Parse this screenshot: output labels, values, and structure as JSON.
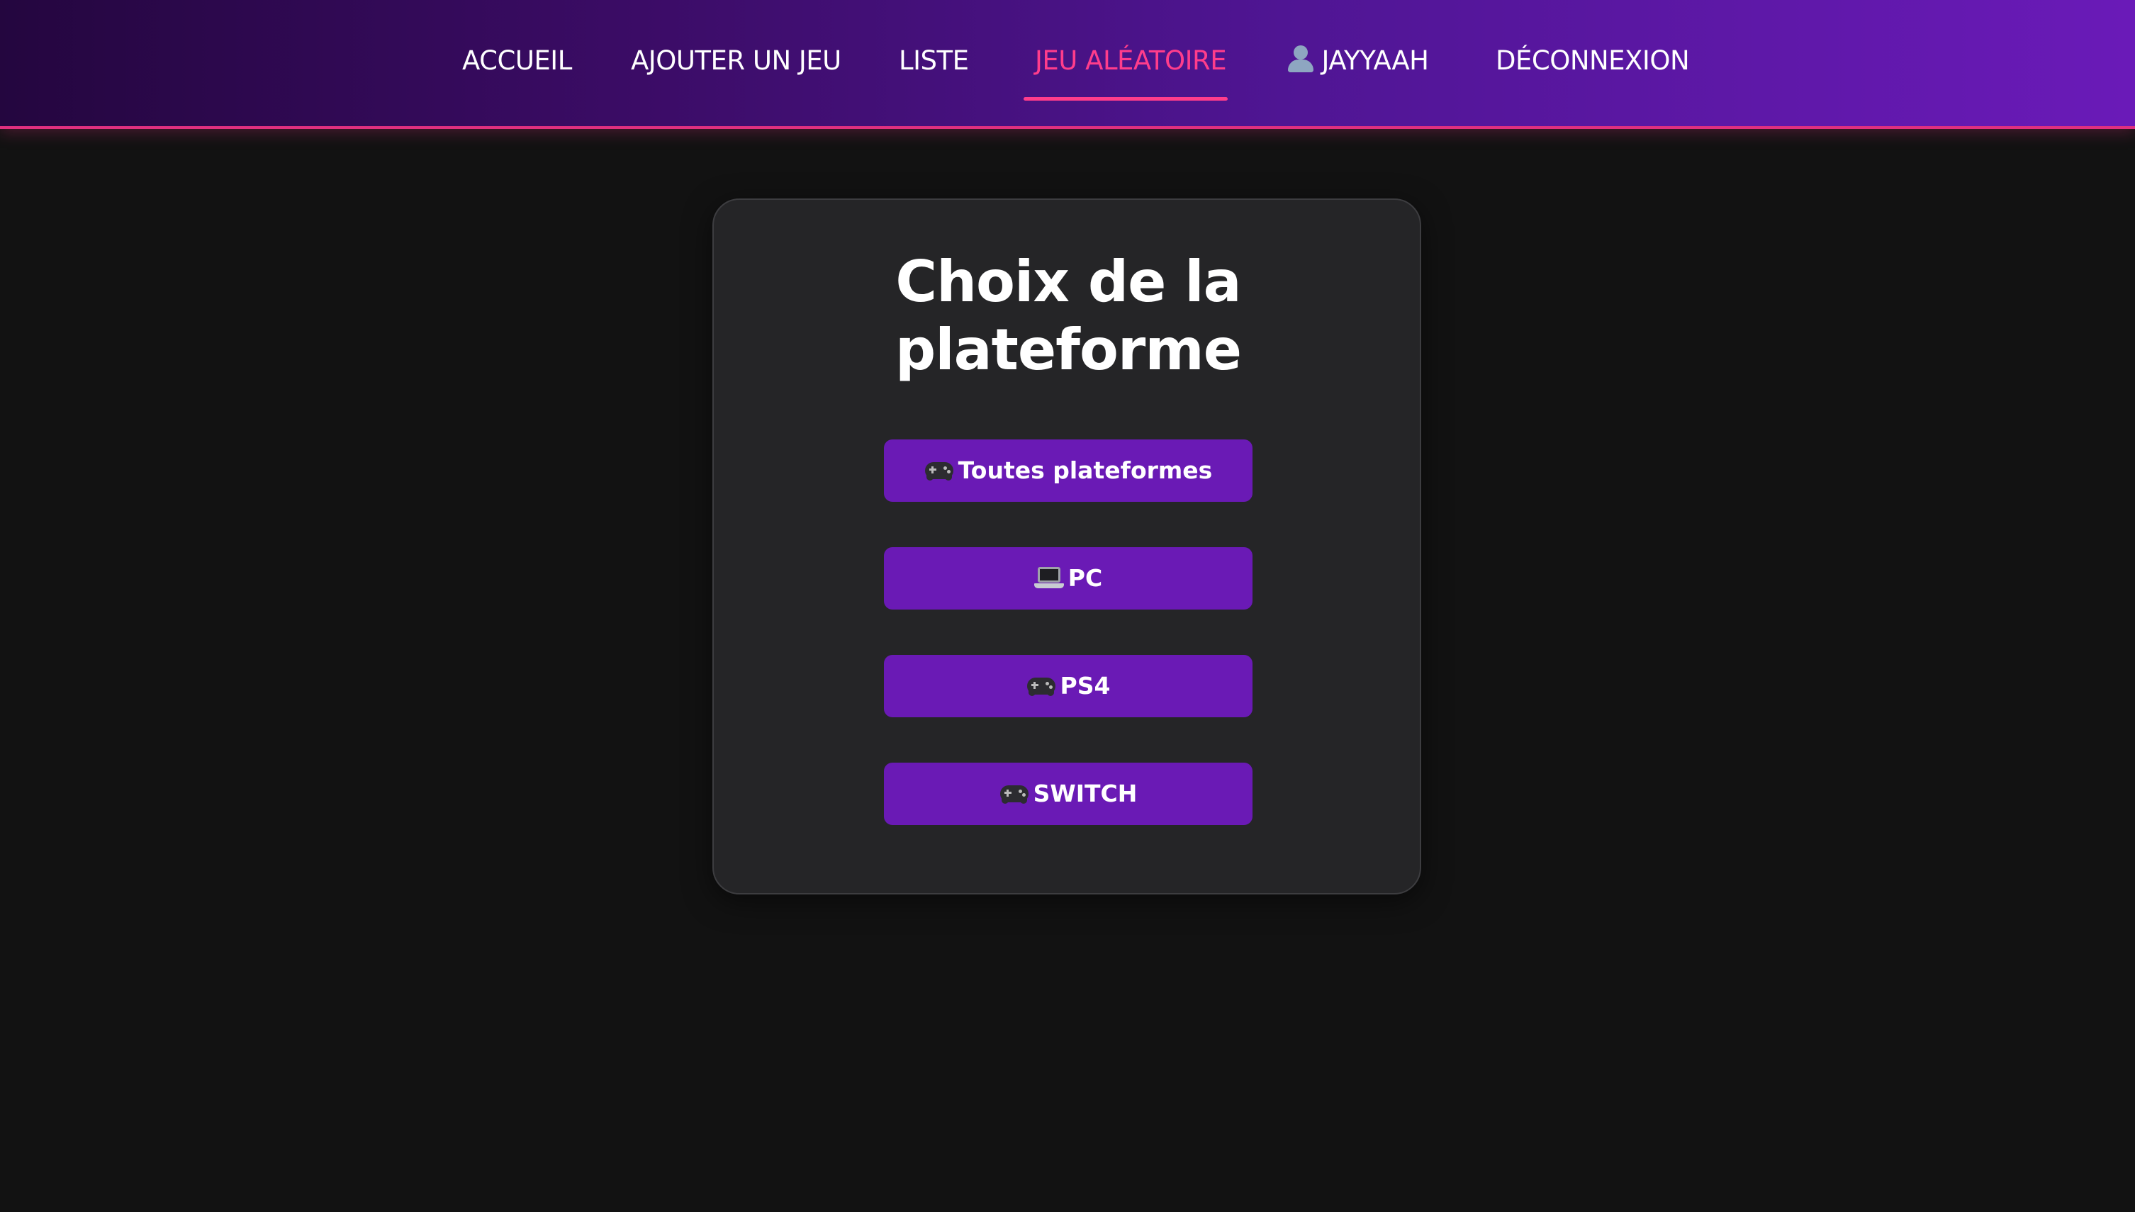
{
  "nav": {
    "items": [
      {
        "label": "ACCUEIL"
      },
      {
        "label": "AJOUTER UN JEU"
      },
      {
        "label": "LISTE"
      },
      {
        "label": "JEU ALÉATOIRE",
        "active": true
      },
      {
        "label": "JAYYAAH",
        "icon": "user-icon"
      },
      {
        "label": "DÉCONNEXION"
      }
    ],
    "active_color": "#ff3d8b"
  },
  "card": {
    "title_line1": "Choix de la",
    "title_line2": "plateforme",
    "buttons": [
      {
        "label": "Toutes plateformes",
        "icon": "gamepad-icon"
      },
      {
        "label": "PC",
        "icon": "laptop-icon"
      },
      {
        "label": "PS4",
        "icon": "gamepad-icon"
      },
      {
        "label": "SWITCH",
        "icon": "gamepad-icon"
      }
    ]
  },
  "colors": {
    "background": "#121212",
    "card": "#252527",
    "button": "#6a1ab5",
    "nav_gradient_start": "#24063f",
    "nav_gradient_end": "#6a1ab8",
    "accent": "#e0307f"
  }
}
